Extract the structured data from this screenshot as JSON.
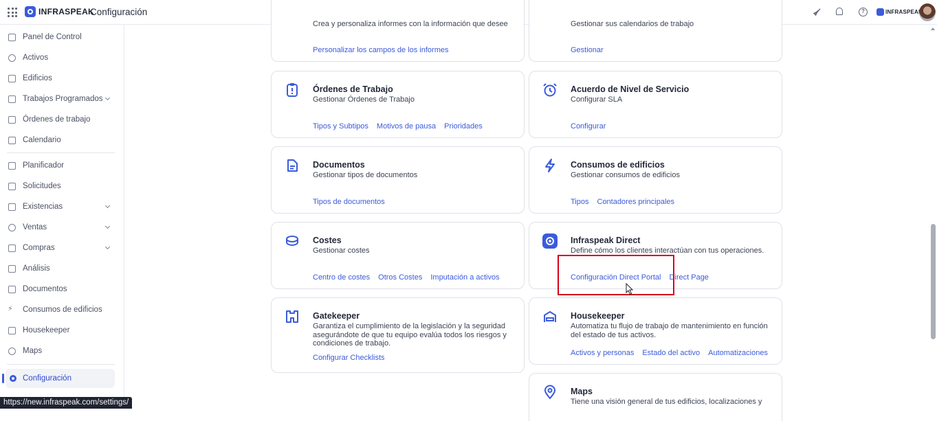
{
  "header": {
    "brand": "INFRASPEAK",
    "page_title": "Configuración",
    "mini_brand": "INFRASPEAK"
  },
  "sidebar": {
    "items": [
      {
        "label": "Panel de Control",
        "icon": "dashboard-icon"
      },
      {
        "label": "Activos",
        "icon": "assets-icon"
      },
      {
        "label": "Edificios",
        "icon": "building-icon"
      },
      {
        "label": "Trabajos Programados",
        "icon": "calendar-check-icon"
      },
      {
        "label": "Órdenes de trabajo",
        "icon": "clipboard-icon"
      },
      {
        "label": "Calendario",
        "icon": "calendar-icon"
      },
      {
        "label": "Planificador",
        "icon": "planner-icon"
      },
      {
        "label": "Solicitudes",
        "icon": "request-icon"
      },
      {
        "label": "Existencias",
        "icon": "stock-icon"
      },
      {
        "label": "Ventas",
        "icon": "tag-icon"
      },
      {
        "label": "Compras",
        "icon": "cart-icon"
      },
      {
        "label": "Análisis",
        "icon": "chart-icon"
      },
      {
        "label": "Documentos",
        "icon": "document-icon"
      },
      {
        "label": "Consumos de edificios",
        "icon": "bolt-icon"
      },
      {
        "label": "Housekeeper",
        "icon": "bed-icon"
      },
      {
        "label": "Maps",
        "icon": "pin-icon"
      },
      {
        "label": "Configuración",
        "icon": "gear-icon"
      }
    ]
  },
  "status_url": "https://new.infraspeak.com/settings/",
  "cards": {
    "reports_top": {
      "desc": "Crea y personaliza informes con la información que desee",
      "links": [
        "Personalizar los campos de los informes"
      ]
    },
    "calendars_top": {
      "desc": "Gestionar sus calendarios de trabajo",
      "links": [
        "Gestionar"
      ]
    },
    "work_orders": {
      "title": "Órdenes de Trabajo",
      "desc": "Gestionar Órdenes de Trabajo",
      "links": [
        "Tipos y Subtipos",
        "Motivos de pausa",
        "Prioridades"
      ]
    },
    "sla": {
      "title": "Acuerdo de Nivel de Servicio",
      "desc": "Configurar SLA",
      "links": [
        "Configurar"
      ]
    },
    "documents": {
      "title": "Documentos",
      "desc": "Gestionar tipos de documentos",
      "links": [
        "Tipos de documentos"
      ]
    },
    "consumption": {
      "title": "Consumos de edificios",
      "desc": "Gestionar consumos de edificios",
      "links": [
        "Tipos",
        "Contadores principales"
      ]
    },
    "costs": {
      "title": "Costes",
      "desc": "Gestionar costes",
      "links": [
        "Centro de costes",
        "Otros Costes",
        "Imputación a activos"
      ]
    },
    "direct": {
      "title": "Infraspeak Direct",
      "desc": "Define cómo los clientes interactúan con tus operaciones.",
      "links": [
        "Configuración Direct Portal",
        "Direct Page"
      ]
    },
    "gatekeeper": {
      "title": "Gatekeeper",
      "desc": "Garantiza el cumplimiento de la legislación y la seguridad asegurándote de que tu equipo evalúa todos los riesgos y condiciones de trabajo.",
      "links": [
        "Configurar Checklists"
      ]
    },
    "housekeeper": {
      "title": "Housekeeper",
      "desc": "Automatiza tu flujo de trabajo de mantenimiento en función del estado de tus activos.",
      "links": [
        "Activos y personas",
        "Estado del activo",
        "Automatizaciones"
      ]
    },
    "maps": {
      "title": "Maps",
      "desc": "Tiene una visión general de tus edificios, localizaciones y"
    }
  },
  "colors": {
    "accent": "#3b5bdb",
    "highlight": "#d6001c"
  }
}
